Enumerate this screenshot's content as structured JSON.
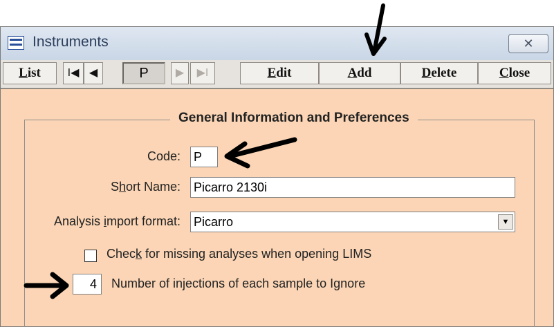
{
  "window": {
    "title": "Instruments",
    "close_glyph": "✕"
  },
  "toolbar": {
    "list_label": "L",
    "list_rest": "ist",
    "first_glyph": "I◀",
    "prev_glyph": "◀",
    "current_record": "P",
    "next_glyph": "▶",
    "last_glyph": "▶I",
    "edit_label": "E",
    "edit_rest": "dit",
    "add_label": "A",
    "add_rest": "dd",
    "delete_label": "D",
    "delete_rest": "elete",
    "close_label": "C",
    "close_rest": "lose"
  },
  "group": {
    "title": "General Information and Preferences",
    "code": {
      "label": "Code:",
      "value": "P"
    },
    "short_name": {
      "label_pre": "S",
      "label_mnemonic": "h",
      "label_post": "ort Name:",
      "value": "Picarro 2130i"
    },
    "import_format": {
      "label_pre": "Analysis ",
      "label_mnemonic": "i",
      "label_post": "mport format:",
      "value": "Picarro"
    },
    "missing_check": {
      "label_pre": "Chec",
      "label_mnemonic": "k",
      "label_post": " for missing analyses when opening LIMS",
      "checked": false
    },
    "injections": {
      "value": "4",
      "label": "Number of injections of each sample to Ignore"
    }
  },
  "annotations": {
    "arrow_color": "#000000"
  }
}
